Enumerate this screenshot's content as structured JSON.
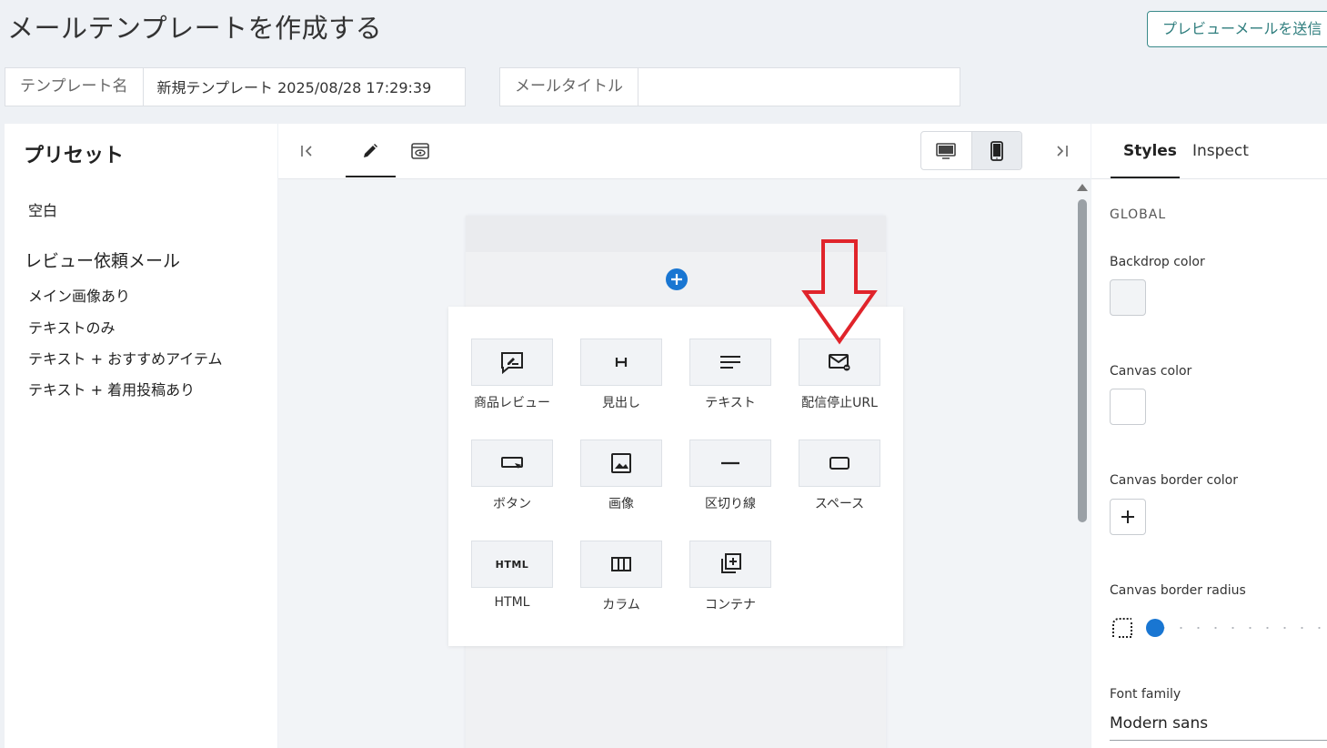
{
  "page": {
    "title": "メールテンプレートを作成する",
    "preview_button": "プレビューメールを送信"
  },
  "fields": {
    "template_name_label": "テンプレート名",
    "template_name_value": "新規テンプレート 2025/08/28 17:29:39",
    "mail_title_label": "メールタイトル",
    "mail_title_value": ""
  },
  "presets": {
    "heading": "プリセット",
    "blank": "空白",
    "group_title": "レビュー依頼メール",
    "items": [
      "メイン画像あり",
      "テキストのみ",
      "テキスト + おすすめアイテム",
      "テキスト + 着用投稿あり"
    ]
  },
  "blocks": [
    {
      "label": "商品レビュー",
      "icon": "review-icon"
    },
    {
      "label": "見出し",
      "icon": "heading-icon"
    },
    {
      "label": "テキスト",
      "icon": "text-icon"
    },
    {
      "label": "配信停止URL",
      "icon": "unsubscribe-mail-icon"
    },
    {
      "label": "ボタン",
      "icon": "button-icon"
    },
    {
      "label": "画像",
      "icon": "image-icon"
    },
    {
      "label": "区切り線",
      "icon": "divider-icon"
    },
    {
      "label": "スペース",
      "icon": "spacer-icon"
    },
    {
      "label": "HTML",
      "icon": "html-icon",
      "icon_text": "HTML"
    },
    {
      "label": "カラム",
      "icon": "columns-icon"
    },
    {
      "label": "コンテナ",
      "icon": "container-icon"
    }
  ],
  "inspector": {
    "tabs": [
      "Styles",
      "Inspect"
    ],
    "section": "GLOBAL",
    "backdrop_label": "Backdrop color",
    "backdrop_color": "#f2f4f6",
    "canvas_label": "Canvas color",
    "canvas_color": "#ffffff",
    "border_color_label": "Canvas border color",
    "border_radius_label": "Canvas border radius",
    "border_radius_value": 0,
    "font_family_label": "Font family",
    "font_family_value": "Modern sans"
  },
  "colors": {
    "accent": "#1976d2",
    "annotation_arrow": "#e0242b",
    "preview_border": "#3a8a8a"
  }
}
